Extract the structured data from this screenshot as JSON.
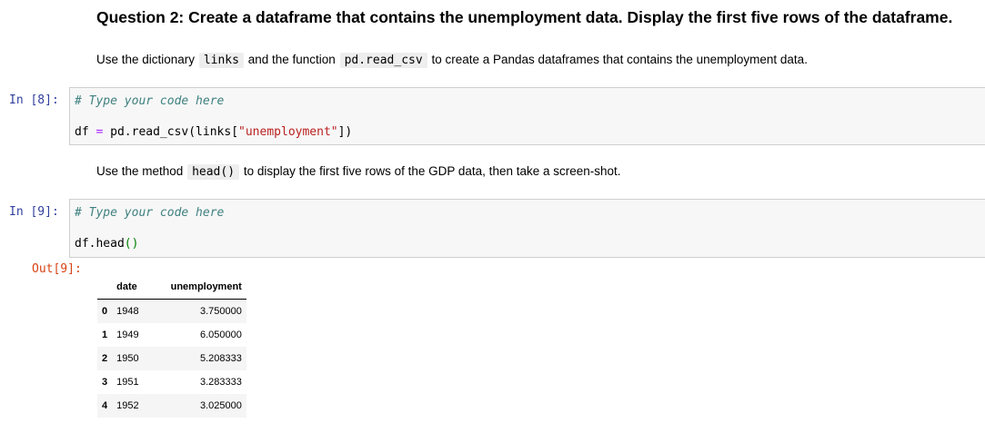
{
  "question": {
    "heading": "Question 2: Create a dataframe that contains the unemployment data. Display the first five rows of the dataframe.",
    "intro": {
      "t1": "Use the dictionary",
      "c1": "links",
      "t2": "and the function",
      "c2": "pd.read_csv",
      "t3": "to create a Pandas dataframes that contains the unemployment data."
    }
  },
  "cell8": {
    "prompt": "In [8]:",
    "comment": "# Type your code here",
    "line2": {
      "a": "df ",
      "op": "=",
      "b": " pd.read_csv(links[",
      "str": "\"unemployment\"",
      "c": "])"
    }
  },
  "instruction": {
    "t1": "Use the method",
    "c1": "head()",
    "t2": "to display the first five rows of the GDP data, then take a screen-shot."
  },
  "cell9": {
    "prompt": "In [9]:",
    "comment": "# Type your code here",
    "code": "df.head",
    "parens": "()"
  },
  "output9": {
    "prompt": "Out[9]:",
    "columns": [
      "",
      "date",
      "unemployment"
    ],
    "rows": [
      {
        "index": "0",
        "date": "1948",
        "unemployment": "3.750000"
      },
      {
        "index": "1",
        "date": "1949",
        "unemployment": "6.050000"
      },
      {
        "index": "2",
        "date": "1950",
        "unemployment": "5.208333"
      },
      {
        "index": "3",
        "date": "1951",
        "unemployment": "3.283333"
      },
      {
        "index": "4",
        "date": "1952",
        "unemployment": "3.025000"
      }
    ]
  },
  "colors": {
    "in_prompt": "#303f9f",
    "out_prompt": "#d84315",
    "comment": "#408080",
    "string": "#ba2121",
    "operator": "#aa22ff",
    "paren": "#008000",
    "cell_bg": "#f7f7f7"
  }
}
